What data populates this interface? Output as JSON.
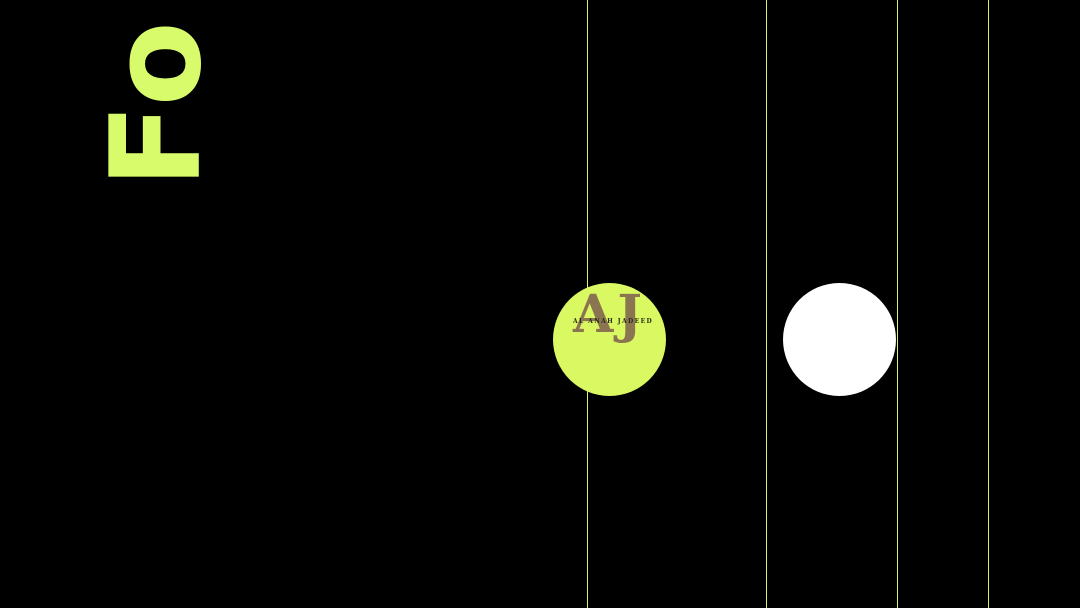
{
  "colors": {
    "background": "#000000",
    "accent": "#d7fb6b",
    "line": "#d4f56a",
    "white": "#ffffff",
    "logo_text": "#8a7550"
  },
  "headline": {
    "text": "Fo"
  },
  "logo": {
    "monogram": "AJ",
    "subtitle": "AL ANAH JADEED"
  }
}
